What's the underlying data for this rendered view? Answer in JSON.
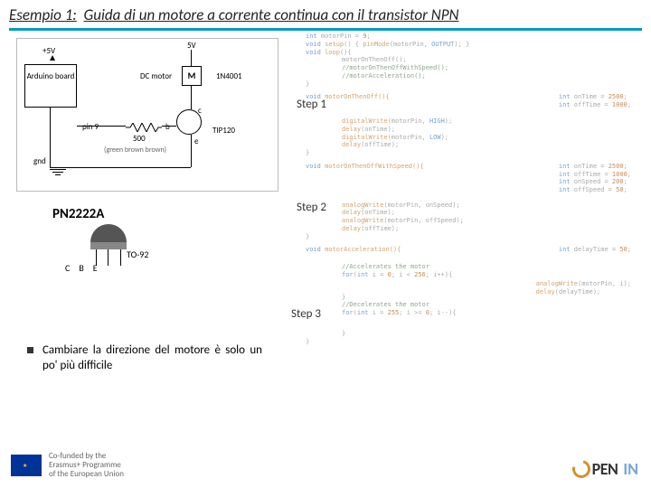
{
  "title": {
    "prefix": "Esempio 1:",
    "rest": "Guida di un motore a corrente continua con il transistor NPN"
  },
  "circuit": {
    "arduino": "Arduino board",
    "pin9": "pin 9",
    "gnd": "gnd",
    "v5a": "+5V",
    "v5b": "5V",
    "dcmotor": "DC motor",
    "motor_sym": "M",
    "diode": "1N4001",
    "tip": "TIP120",
    "r": "500",
    "gbr": "(green brown brown)",
    "b": "b",
    "c": "c",
    "e": "e"
  },
  "transistor": {
    "name": "PN2222A",
    "pkg": "TO-92",
    "pins": [
      "C",
      "B",
      "E"
    ]
  },
  "bullet": "Cambiare la direzione del motore è solo un po' più difficile",
  "steps": {
    "s1": "Step 1",
    "s2": "Step 2",
    "s3": "Step 3"
  },
  "code": {
    "setup": {
      "l1a": "int",
      "l1b": " motorPin = ",
      "l1c": "9",
      "l1d": ";",
      "l2a": "void",
      "l2b": " setup",
      "l2c": "() { ",
      "l2d": "pinMode",
      "l2e": "(motorPin, ",
      "l2f": "OUTPUT",
      "l2g": "); }",
      "l3a": "void",
      "l3b": " loop",
      "l3c": "(){",
      "l4": "motorOnThenOff();",
      "l5": "//motorOnThenOffWithSpeed();",
      "l6": "//motorAcceleration();",
      "l7": "}"
    },
    "f1": {
      "h1": "void",
      "h2": " motorOnThenOff(){",
      "v1a": "int",
      "v1b": " onTime = ",
      "v1c": "2500",
      "v1d": ";",
      "v2a": "int",
      "v2b": " offTime = ",
      "v2c": "1000",
      "v2d": ";",
      "b1a": "digitalWrite",
      "b1b": "(motorPin, ",
      "b1c": "HIGH",
      "b1d": ");",
      "b2a": "delay",
      "b2b": "(onTime);",
      "b3a": "digitalWrite",
      "b3b": "(motorPin, ",
      "b3c": "LOW",
      "b3d": ");",
      "b4a": "delay",
      "b4b": "(offTime);",
      "end": "}"
    },
    "f2": {
      "h1": "void",
      "h2": " motorOnThenOffWithSpeed(){",
      "v1a": "int",
      "v1b": " onTime = ",
      "v1c": "2500",
      "v1d": ";",
      "v2a": "int",
      "v2b": " offTime = ",
      "v2c": "1000",
      "v2d": ";",
      "v3a": "int",
      "v3b": " onSpeed = ",
      "v3c": "200",
      "v3d": ";",
      "v4a": "int",
      "v4b": " offSpeed = ",
      "v4c": "50",
      "v4d": ";",
      "b1a": "analogWrite",
      "b1b": "(motorPin, onSpeed);",
      "b2a": "delay",
      "b2b": "(onTime);",
      "b3a": "analogWrite",
      "b3b": "(motorPin, offSpeed);",
      "b4a": "delay",
      "b4b": "(offTime);",
      "end": "}"
    },
    "f3": {
      "h1": "void",
      "h2": " motorAcceleration(){",
      "v1a": "int",
      "v1b": " delayTime = ",
      "v1c": "50",
      "v1d": ";",
      "c1": "//Accelerates the motor",
      "fa1": "for",
      "fa2": "(",
      "fa3": "int",
      "fa4": " i = ",
      "fa5": "0",
      "fa6": "; i < ",
      "fa7": "256",
      "fa8": "; i++){",
      "ba1a": "analogWrite",
      "ba1b": "(motorPin, i);",
      "ba2a": "delay",
      "ba2b": "(delayTime);",
      "bae": "}",
      "c2": "//Decelerates the motor",
      "fd1": "for",
      "fd2": "(",
      "fd3": "int",
      "fd4": " i = ",
      "fd5": "255",
      "fd6": "; i >= ",
      "fd7": "0",
      "fd8": "; i--){",
      "end2": "}",
      "end": "}"
    }
  },
  "footer": {
    "cofund1": "Co-funded by the",
    "cofund2": "Erasmus+ Programme",
    "cofund3": "of the European Union",
    "logo1": "PEN",
    "logo2": "IN"
  }
}
